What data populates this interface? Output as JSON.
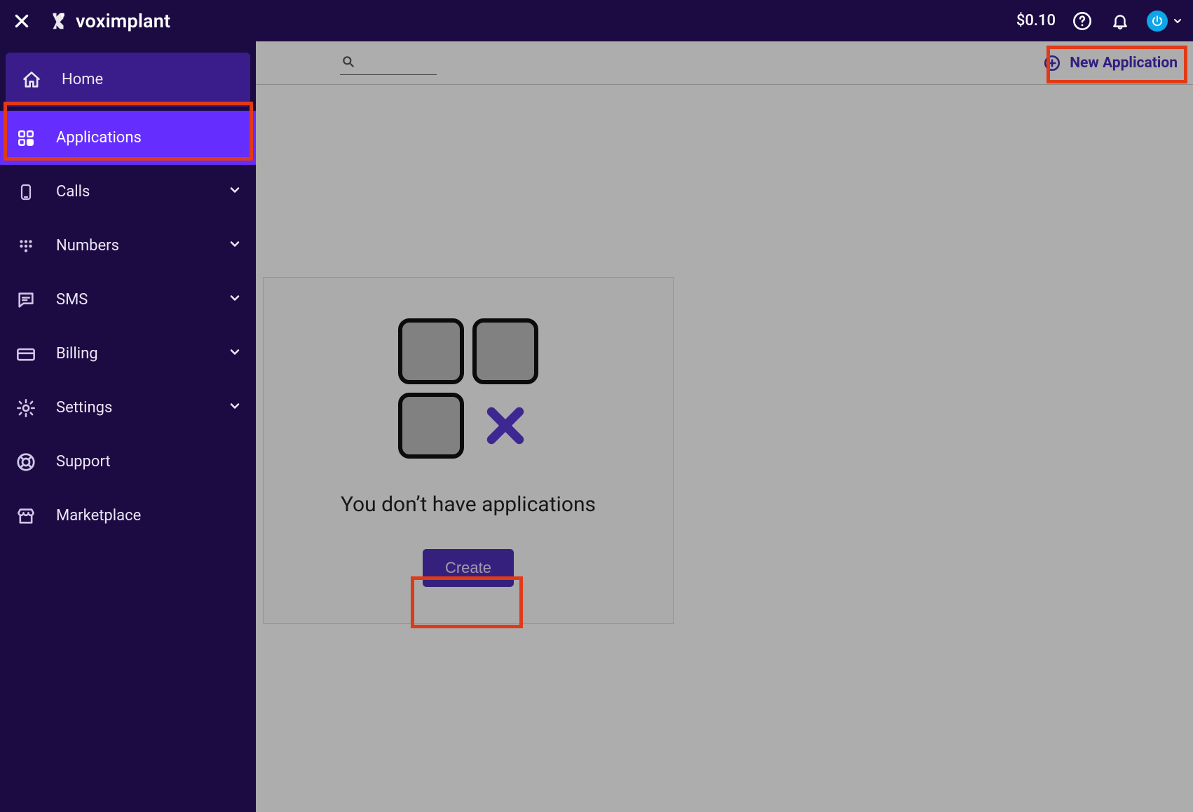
{
  "brand": {
    "name": "voximplant"
  },
  "header": {
    "balance": "$0.10"
  },
  "sidebar": {
    "items": [
      {
        "label": "Home",
        "key": "home"
      },
      {
        "label": "Applications",
        "key": "applications"
      },
      {
        "label": "Calls",
        "key": "calls"
      },
      {
        "label": "Numbers",
        "key": "numbers"
      },
      {
        "label": "SMS",
        "key": "sms"
      },
      {
        "label": "Billing",
        "key": "billing"
      },
      {
        "label": "Settings",
        "key": "settings"
      },
      {
        "label": "Support",
        "key": "support"
      },
      {
        "label": "Marketplace",
        "key": "marketplace"
      }
    ]
  },
  "toolbar": {
    "search_placeholder": "",
    "new_application_label": "New Application"
  },
  "empty": {
    "message": "You don’t have applications",
    "create_label": "Create"
  },
  "colors": {
    "sidebar_bg": "#1c0b43",
    "accent": "#662dff",
    "highlight": "#e13a17",
    "button": "#4e31b8"
  }
}
